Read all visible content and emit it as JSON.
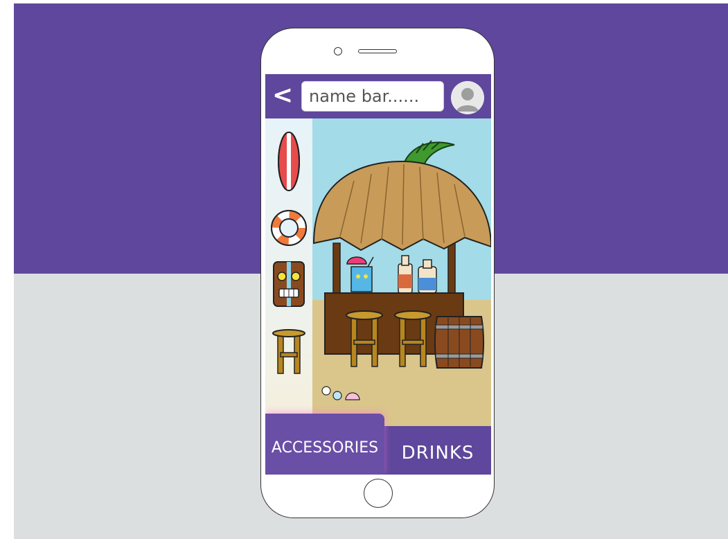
{
  "colors": {
    "brand": "#5e479c",
    "accessories_tab": "#6a4fa6",
    "page_lower": "#dcdfe0"
  },
  "header": {
    "back_glyph": "<",
    "name_placeholder": "name bar......"
  },
  "sidebar": {
    "items": [
      {
        "icon": "surfboard-icon"
      },
      {
        "icon": "life-ring-icon"
      },
      {
        "icon": "tiki-mask-icon"
      },
      {
        "icon": "bar-stool-icon"
      }
    ]
  },
  "scene": {
    "items": [
      "tiki-hut",
      "palm-leaf",
      "cocktail-glass",
      "bottle",
      "bottle",
      "bar-counter",
      "bar-stool",
      "bar-stool",
      "barrel",
      "seashells"
    ]
  },
  "tabs": [
    {
      "label": "ACCESSORIES",
      "active": true
    },
    {
      "label": "DRINKS",
      "active": false
    }
  ]
}
